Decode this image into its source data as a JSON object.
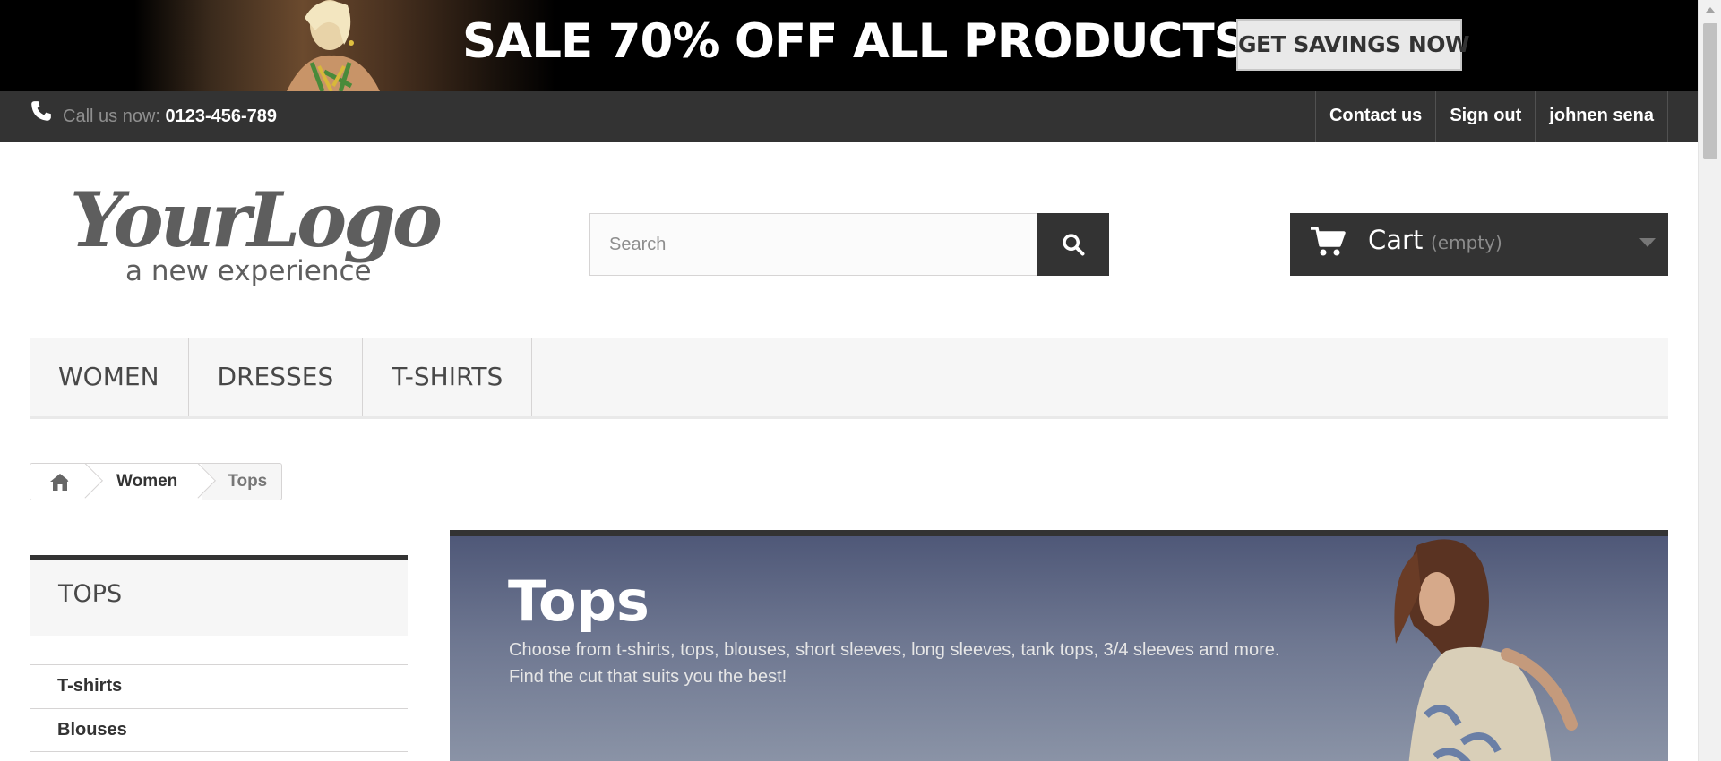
{
  "banner": {
    "headline": "SALE 70% OFF ALL PRODUCTS",
    "button_label": "GET SAVINGS NOW"
  },
  "topbar": {
    "call_label": "Call us now:",
    "phone": "0123-456-789",
    "links": [
      {
        "label": "Contact us"
      },
      {
        "label": "Sign out"
      },
      {
        "label": "johnen sena"
      }
    ]
  },
  "header": {
    "logo_main": "YourLogo",
    "logo_tagline": "a new experience",
    "search": {
      "placeholder": "Search",
      "value": ""
    },
    "cart": {
      "label": "Cart",
      "status": "(empty)"
    }
  },
  "menu": {
    "items": [
      {
        "label": "WOMEN"
      },
      {
        "label": "DRESSES"
      },
      {
        "label": "T-SHIRTS"
      }
    ]
  },
  "breadcrumb": {
    "items": [
      {
        "label": "Women"
      },
      {
        "label": "Tops"
      }
    ]
  },
  "sidebar": {
    "title": "TOPS",
    "categories": [
      {
        "label": "T-shirts"
      },
      {
        "label": "Blouses"
      }
    ]
  },
  "category": {
    "title": "Tops",
    "description_line1": "Choose from t-shirts, tops, blouses, short sleeves, long sleeves, tank tops, 3/4 sleeves and more.",
    "description_line2": "Find the cut that suits you the best!"
  },
  "icons": {
    "phone": "phone-icon",
    "search": "search-icon",
    "cart": "cart-icon",
    "home": "home-icon",
    "dropdown": "chevron-down-icon"
  }
}
